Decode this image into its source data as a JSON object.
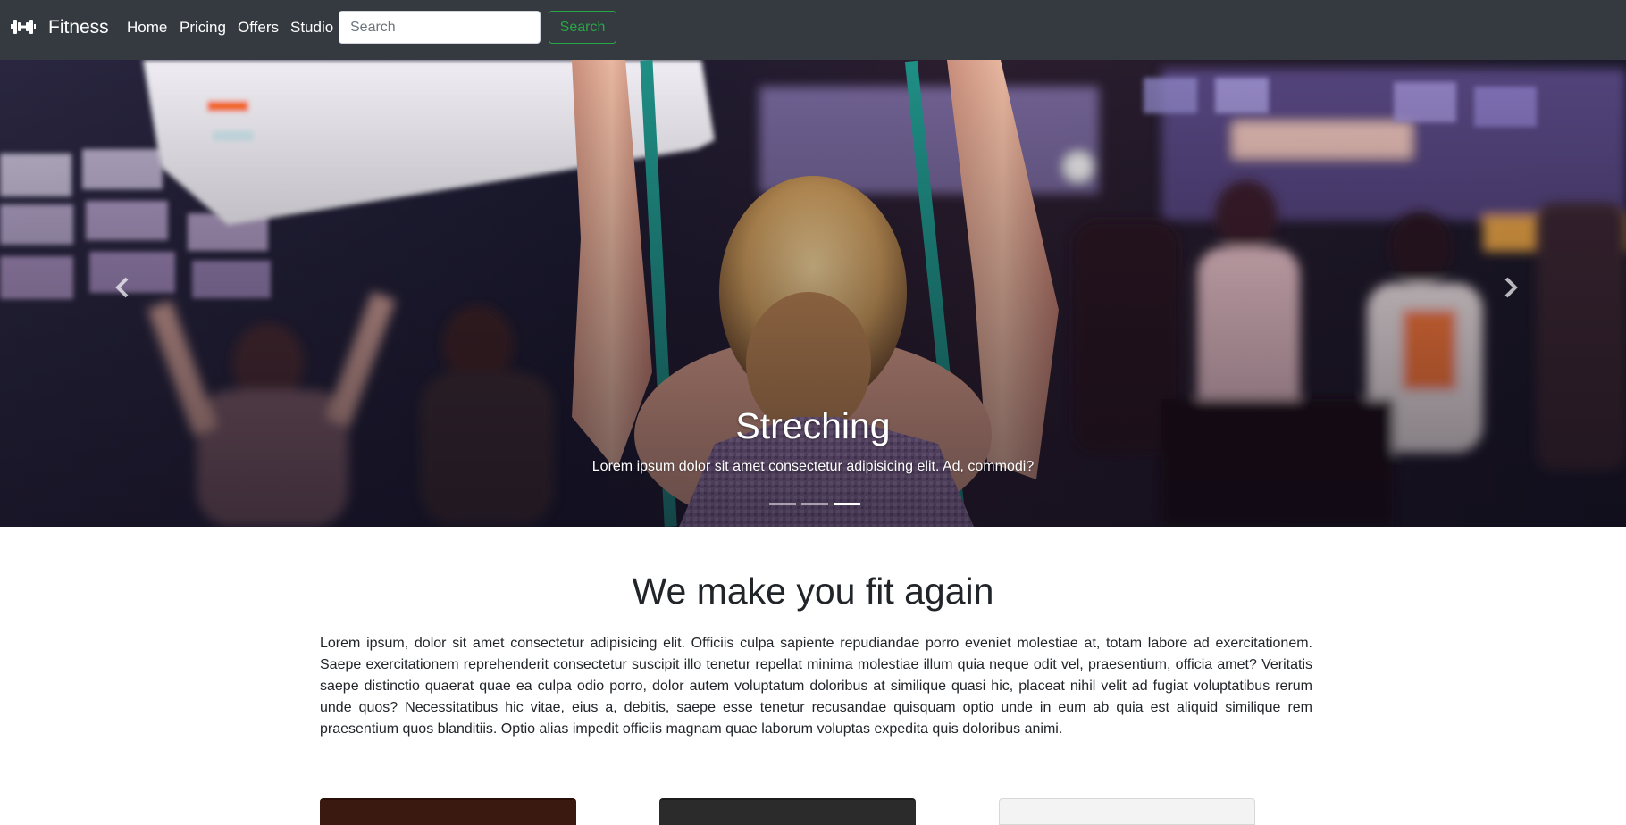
{
  "navbar": {
    "brand_icon": "dumbbell-icon",
    "brand": "Fitness",
    "links": [
      "Home",
      "Pricing",
      "Offers",
      "Studio"
    ],
    "search_placeholder": "Search",
    "search_button": "Search",
    "colors": {
      "background": "#343a40",
      "search_button": "#28a745"
    }
  },
  "carousel": {
    "slide_title": "Streching",
    "slide_text": "Lorem ipsum dolor sit amet consectetur adipisicing elit. Ad, commodi?",
    "prev_icon": "chevron-left-icon",
    "next_icon": "chevron-right-icon",
    "slide_count": 3,
    "active_slide": 3
  },
  "intro": {
    "heading": "We make you fit again",
    "body": "Lorem ipsum, dolor sit amet consectetur adipisicing elit. Officiis culpa sapiente repudiandae porro eveniet molestiae at, totam labore ad exercitationem. Saepe exercitationem reprehenderit consectetur suscipit illo tenetur repellat minima molestiae illum quia neque odit vel, praesentium, officia amet? Veritatis saepe distinctio quaerat quae ea culpa odio porro, dolor autem voluptatum doloribus at similique quasi hic, placeat nihil velit ad fugiat voluptatibus rerum unde quos? Necessitatibus hic vitae, eius a, debitis, saepe esse tenetur recusandae quisquam optio unde in eum ab quia est aliquid similique rem praesentium quos blanditiis. Optio alias impedit officiis magnam quae laborum voluptas expedita quis doloribus animi."
  }
}
